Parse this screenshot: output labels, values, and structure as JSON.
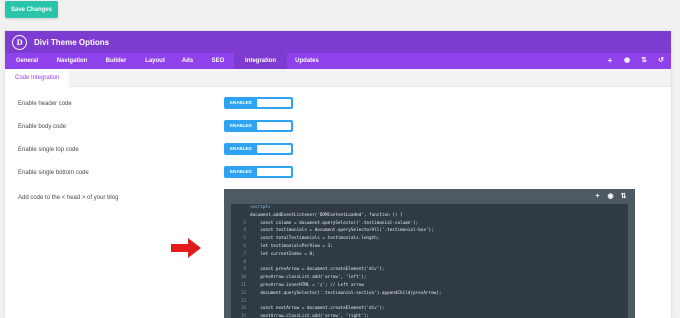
{
  "toolbar": {
    "save_label": "Save Changes"
  },
  "header": {
    "logo_letter": "D",
    "title": "Divi Theme Options"
  },
  "tabs": [
    {
      "label": "General"
    },
    {
      "label": "Navigation"
    },
    {
      "label": "Builder"
    },
    {
      "label": "Layout"
    },
    {
      "label": "Ads"
    },
    {
      "label": "SEO"
    },
    {
      "label": "Integration",
      "active": true
    },
    {
      "label": "Updates"
    }
  ],
  "tab_tools": [
    "plus-icon",
    "clock-icon",
    "sort-icon",
    "undo-icon"
  ],
  "subtab": {
    "label": "Code Integration"
  },
  "settings": [
    {
      "label": "Enable header code",
      "state": "ENABLED"
    },
    {
      "label": "Enable body code",
      "state": "ENABLED"
    },
    {
      "label": "Enable single top code",
      "state": "ENABLED"
    },
    {
      "label": "Enable single bottom code",
      "state": "ENABLED"
    }
  ],
  "head_code": {
    "label": "Add code to the < head > of your blog",
    "toolbar_icons": [
      "plus-icon",
      "clock-icon",
      "sort-icon"
    ],
    "lines": [
      {
        "num": "",
        "text": "<script>"
      },
      {
        "num": "",
        "text": "document.addEventListener('DOMContentLoaded', function () {"
      },
      {
        "num": "3",
        "text": "    const column = document.querySelector('.testimonial-column');"
      },
      {
        "num": "4",
        "text": "    const testimonials = document.querySelectorAll('.testimonial-box');"
      },
      {
        "num": "5",
        "text": "    const totalTestimonials = testimonials.length;"
      },
      {
        "num": "6",
        "text": "    let testimonialsPerView = 3;"
      },
      {
        "num": "7",
        "text": "    let currentIndex = 0;"
      },
      {
        "num": "8",
        "text": ""
      },
      {
        "num": "9",
        "text": "    const prevArrow = document.createElement('div');"
      },
      {
        "num": "10",
        "text": "    prevArrow.classList.add('arrow', 'left');"
      },
      {
        "num": "11",
        "text": "    prevArrow.innerHTML = '❮'; // Left arrow"
      },
      {
        "num": "12",
        "text": "    document.querySelector('.testimonial-section').appendChild(prevArrow);"
      },
      {
        "num": "13",
        "text": ""
      },
      {
        "num": "14",
        "text": "    const nextArrow = document.createElement('div');"
      },
      {
        "num": "15",
        "text": "    nextArrow.classList.add('arrow', 'right');"
      }
    ]
  },
  "annotation": {
    "arrow_color": "#e31b1b"
  },
  "colors": {
    "purple_header": "#7e3bd0",
    "purple_tabs": "#8f42ec",
    "save_green": "#29c4a9",
    "toggle_blue": "#2ea3f2",
    "editor_bg": "#2f3a44"
  }
}
